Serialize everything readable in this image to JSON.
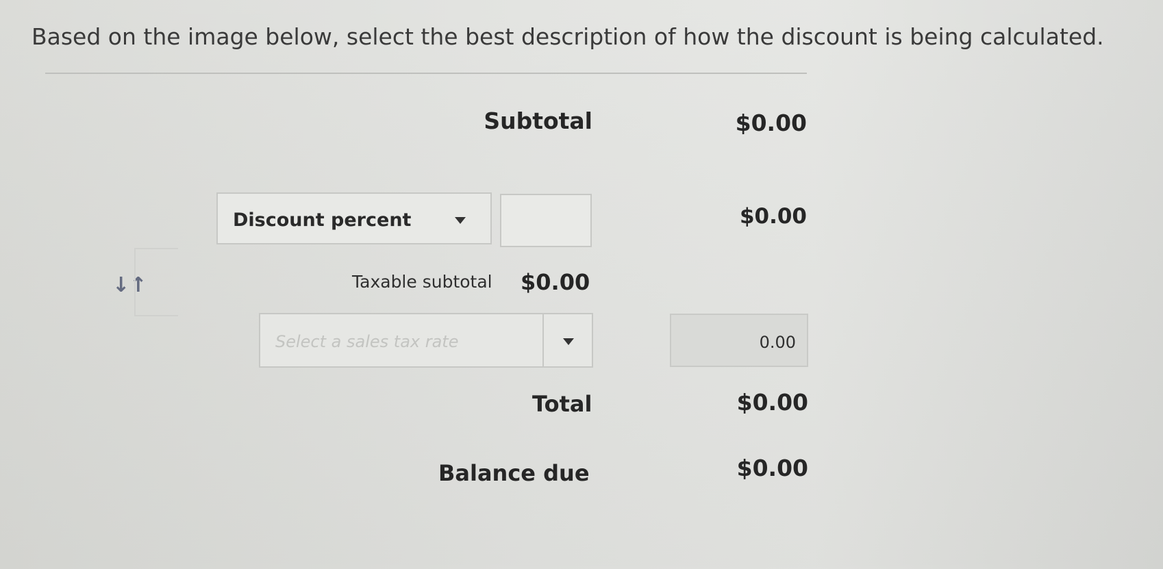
{
  "question": "Based on the image below, select the best description of how the discount is being calculated.",
  "summary": {
    "subtotal_label": "Subtotal",
    "subtotal_amount": "$0.00",
    "discount_type": "Discount percent",
    "discount_value": "",
    "discount_amount": "$0.00",
    "taxable_subtotal_label": "Taxable subtotal",
    "taxable_subtotal_amount": "$0.00",
    "tax_rate_placeholder": "Select a sales tax rate",
    "tax_amount": "0.00",
    "total_label": "Total",
    "total_amount": "$0.00",
    "balance_due_label": "Balance due",
    "balance_due_amount": "$0.00"
  },
  "icons": {
    "sort": "sort-arrows-icon",
    "dropdown": "chevron-down-icon"
  },
  "colors": {
    "text": "#262626",
    "placeholder": "#c3c4c1",
    "border": "#c7c8c5",
    "icon": "#646b80"
  }
}
